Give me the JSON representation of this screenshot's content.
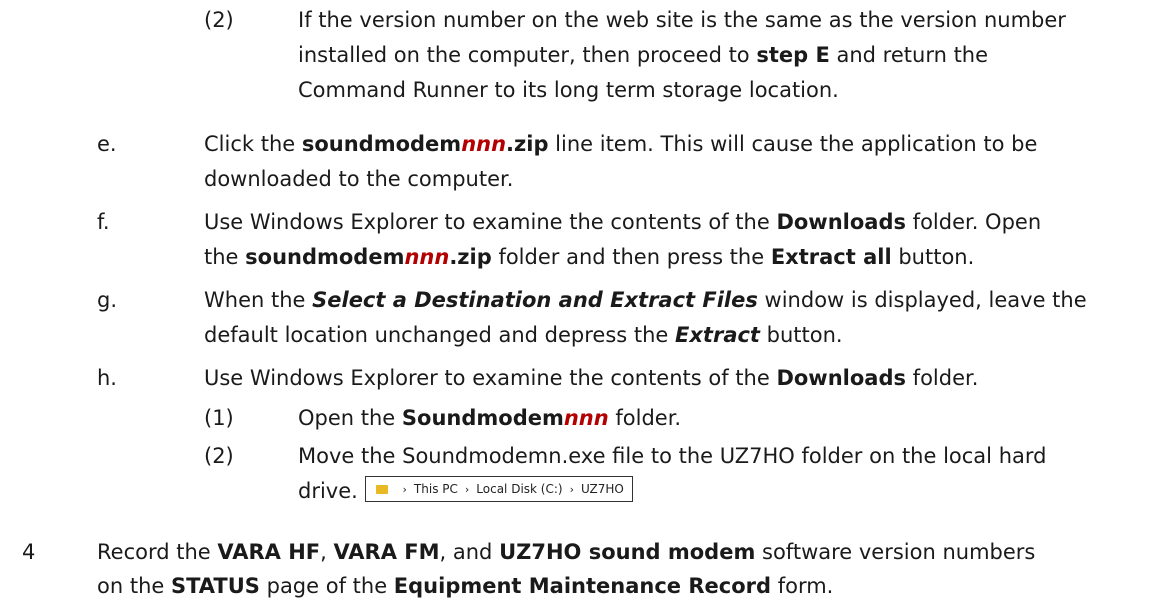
{
  "items": {
    "d2": {
      "marker": "(2)",
      "l1": [
        "If the version number on the web site is the same as the version number"
      ],
      "l2": [
        "installed on the computer, then proceed to ",
        "step E",
        " and return the"
      ],
      "l3": [
        "Command Runner to its long term storage location."
      ]
    },
    "e": {
      "marker": "e.",
      "l1": [
        "Click the ",
        "soundmodem",
        "nnn",
        ".zip",
        " line item. This will cause the application to be"
      ],
      "l2": [
        "downloaded to the computer."
      ]
    },
    "f": {
      "marker": "f.",
      "l1": [
        "Use Windows Explorer to examine the contents of the ",
        "Downloads",
        " folder. Open"
      ],
      "l2": [
        "the ",
        "soundmodem",
        "nnn",
        ".zip",
        " folder and then press the ",
        "Extract all",
        " button."
      ]
    },
    "g": {
      "marker": "g.",
      "l1": [
        "When the ",
        "Select a Destination and Extract Files",
        " window is displayed, leave the"
      ],
      "l2": [
        "default location unchanged and depress the ",
        "Extract",
        " button."
      ]
    },
    "h": {
      "marker": "h.",
      "l1": [
        "Use Windows Explorer to examine the contents of the ",
        "Downloads",
        " folder."
      ],
      "sub1": {
        "marker": "(1)",
        "l1": [
          "Open the ",
          "Soundmodem",
          "nnn",
          " folder."
        ]
      },
      "sub2": {
        "marker": "(2)",
        "l1": [
          "Move the Soundmodemn.exe file to the UZ7HO folder on the local hard"
        ],
        "l2": [
          "drive."
        ]
      }
    },
    "step4": {
      "marker": "4",
      "l1": [
        "Record the ",
        "VARA HF",
        ", ",
        "VARA FM",
        ", and ",
        "UZ7HO sound modem",
        " software version numbers"
      ],
      "l2": [
        "on the ",
        "STATUS",
        " page of the ",
        "Equipment Maintenance Record",
        " form."
      ]
    }
  },
  "breadcrumb": {
    "folder_icon": "folder-icon",
    "separator": "›",
    "parts": [
      "This PC",
      "Local Disk (C:)",
      "UZ7HO"
    ]
  },
  "colors": {
    "highlight": "#b30000",
    "text": "#1a1a1a"
  }
}
